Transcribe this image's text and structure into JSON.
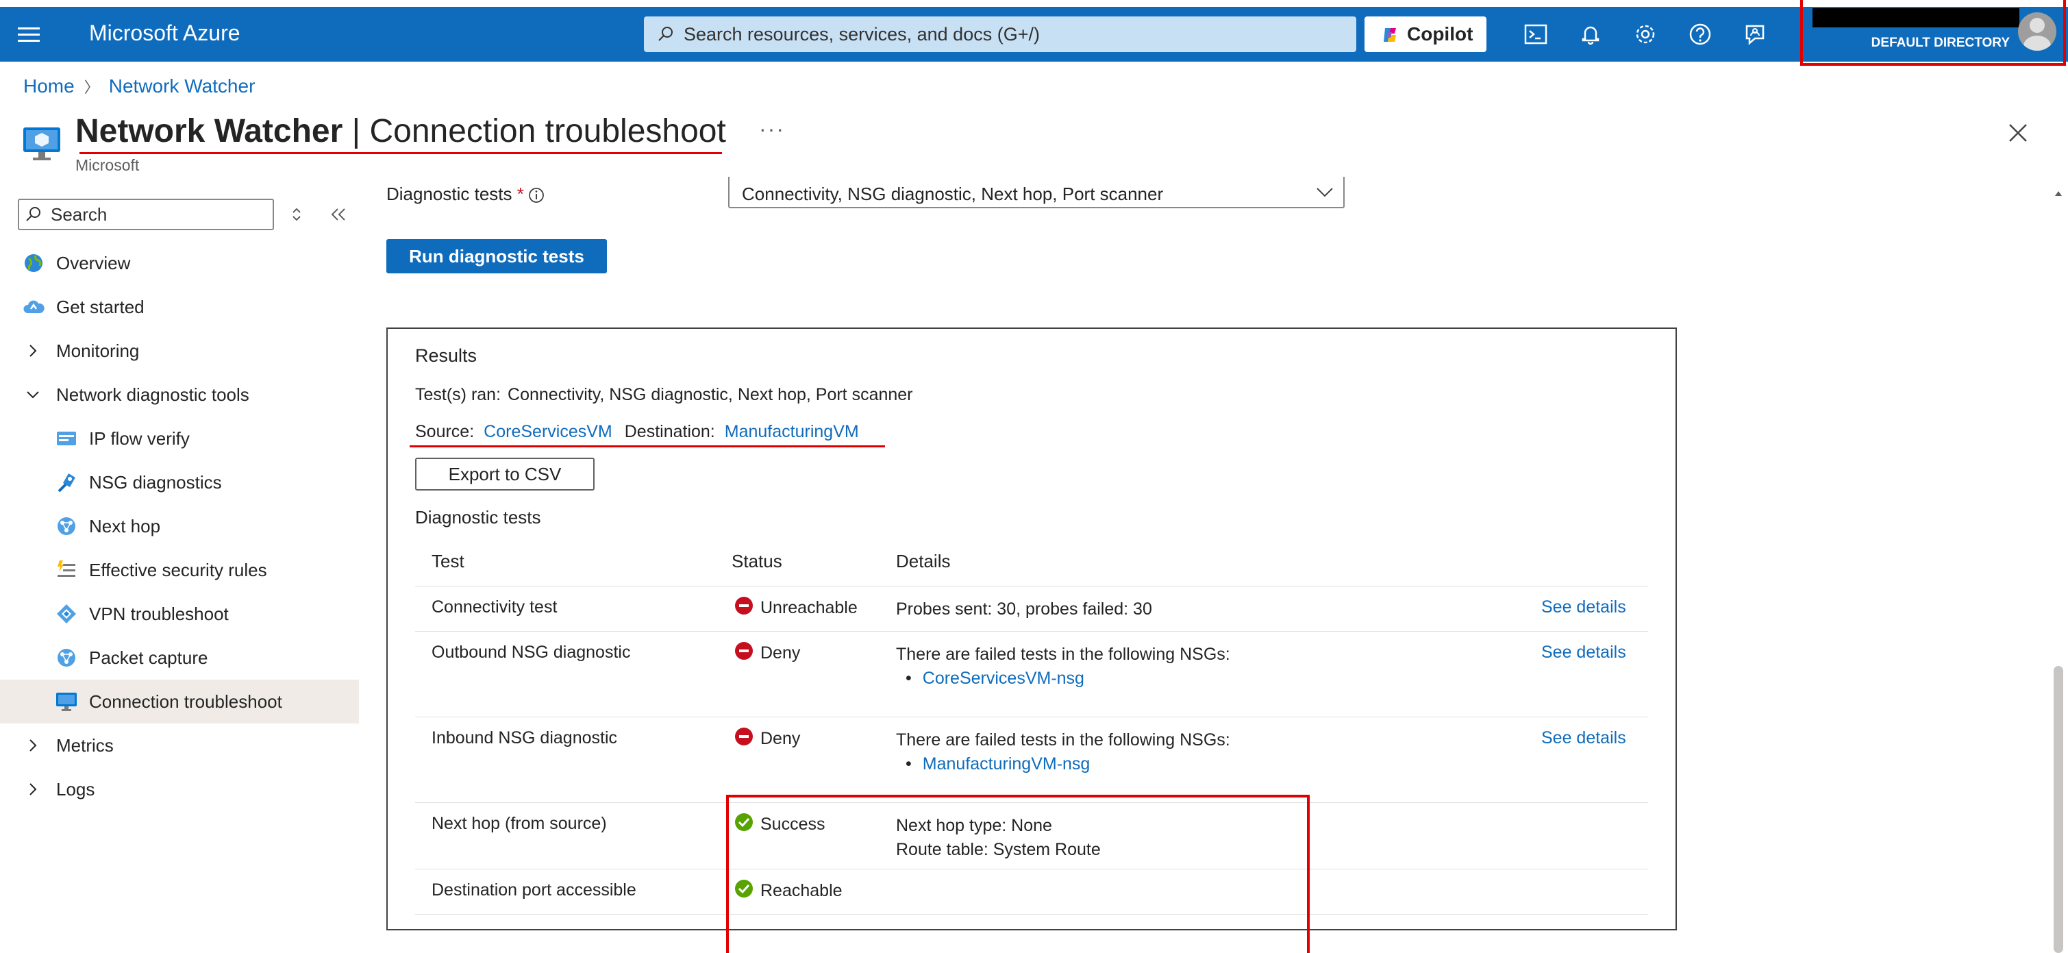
{
  "topbar": {
    "brand": "Microsoft Azure",
    "search_placeholder": "Search resources, services, and docs (G+/)",
    "copilot_label": "Copilot",
    "icons": [
      "cloud-shell-icon",
      "bell-icon",
      "gear-icon",
      "help-icon",
      "feedback-icon"
    ],
    "directory_label": "DEFAULT DIRECTORY"
  },
  "breadcrumb": {
    "home": "Home",
    "current": "Network Watcher"
  },
  "header": {
    "title_bold": "Network Watcher",
    "title_rest": " | Connection troubleshoot",
    "more": "···",
    "subtitle": "Microsoft"
  },
  "sidebar": {
    "search_placeholder": "Search",
    "items": [
      {
        "label": "Overview",
        "icon": "globe-icon",
        "level": 0
      },
      {
        "label": "Get started",
        "icon": "cloud-icon",
        "level": 0
      },
      {
        "label": "Monitoring",
        "icon": "chevron-right-icon",
        "level": 0,
        "group": true
      },
      {
        "label": "Network diagnostic tools",
        "icon": "chevron-down-icon",
        "level": 0,
        "group": true
      },
      {
        "label": "IP flow verify",
        "icon": "ip-flow-icon",
        "level": 1
      },
      {
        "label": "NSG diagnostics",
        "icon": "nsg-icon",
        "level": 1
      },
      {
        "label": "Next hop",
        "icon": "network-icon",
        "level": 1
      },
      {
        "label": "Effective security rules",
        "icon": "rules-icon",
        "level": 1
      },
      {
        "label": "VPN troubleshoot",
        "icon": "vpn-icon",
        "level": 1
      },
      {
        "label": "Packet capture",
        "icon": "network-icon",
        "level": 1
      },
      {
        "label": "Connection troubleshoot",
        "icon": "monitor-icon",
        "level": 1,
        "active": true
      },
      {
        "label": "Metrics",
        "icon": "chevron-right-icon",
        "level": 0,
        "group": true
      },
      {
        "label": "Logs",
        "icon": "chevron-right-icon",
        "level": 0,
        "group": true
      }
    ]
  },
  "form": {
    "diag_label": "Diagnostic tests",
    "required_mark": "*",
    "diag_value": "Connectivity, NSG diagnostic, Next hop, Port scanner",
    "run_button": "Run diagnostic tests"
  },
  "results": {
    "title": "Results",
    "tests_ran_label": "Test(s) ran:",
    "tests_ran_value": "Connectivity, NSG diagnostic, Next hop, Port scanner",
    "source_label": "Source:",
    "source_value": "CoreServicesVM",
    "destination_label": "Destination:",
    "destination_value": "ManufacturingVM",
    "export_button": "Export to CSV",
    "diag_heading": "Diagnostic tests",
    "columns": [
      "Test",
      "Status",
      "Details"
    ],
    "rows": [
      {
        "test": "Connectivity test",
        "status": "Unreachable",
        "status_type": "error",
        "details": "Probes sent: 30, probes failed: 30",
        "link": "",
        "see": "See details"
      },
      {
        "test": "Outbound NSG diagnostic",
        "status": "Deny",
        "status_type": "error",
        "details": "There are failed tests in the following NSGs:",
        "link": "CoreServicesVM-nsg",
        "see": "See details"
      },
      {
        "test": "Inbound NSG diagnostic",
        "status": "Deny",
        "status_type": "error",
        "details": "There are failed tests in the following NSGs:",
        "link": "ManufacturingVM-nsg",
        "see": "See details"
      },
      {
        "test": "Next hop (from source)",
        "status": "Success",
        "status_type": "success",
        "details": "Next hop type: None",
        "details2": "Route table: System Route",
        "link": "",
        "see": ""
      },
      {
        "test": "Destination port accessible",
        "status": "Reachable",
        "status_type": "success",
        "details": "",
        "link": "",
        "see": ""
      }
    ]
  },
  "colors": {
    "azure_blue": "#0f6cbd",
    "error": "#c50f1f",
    "success": "#57a300",
    "highlight": "#e00000"
  }
}
